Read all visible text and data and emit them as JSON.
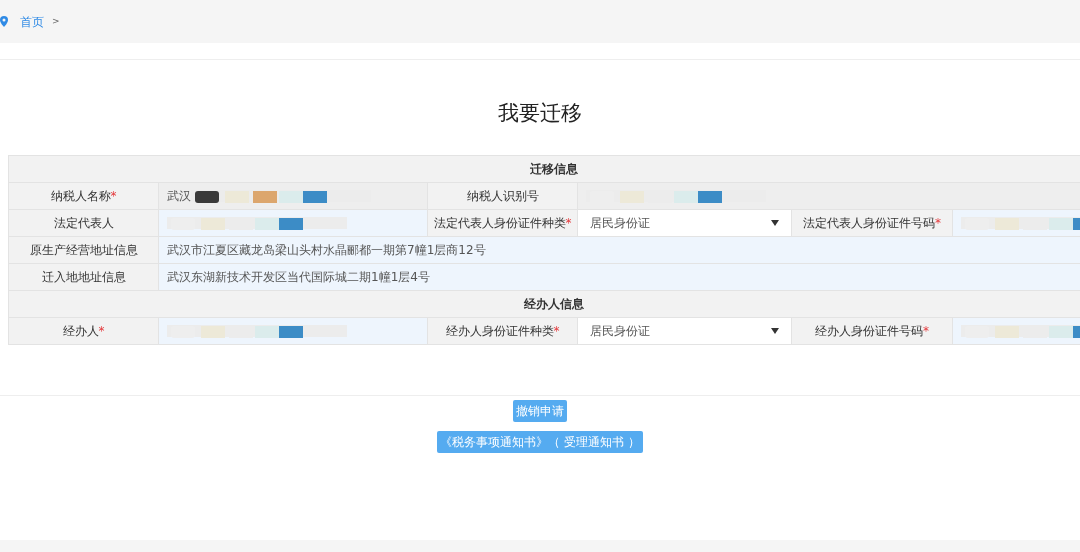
{
  "breadcrumb": {
    "items": [
      {
        "label": "首页"
      }
    ],
    "separator": ">"
  },
  "title": "我要迁移",
  "sections": [
    {
      "heading": "迁移信息",
      "rows": [
        {
          "cells": [
            {
              "kind": "label",
              "text": "纳税人名称",
              "mark": "*"
            },
            {
              "kind": "field",
              "value": "武汉",
              "disabled": true,
              "redacted": true
            },
            {
              "kind": "label",
              "text": "纳税人识别号"
            },
            {
              "kind": "field",
              "disabled": true,
              "redacted": true
            }
          ]
        },
        {
          "cells": [
            {
              "kind": "label",
              "text": "法定代表人"
            },
            {
              "kind": "field",
              "disabled": false,
              "redacted": true
            },
            {
              "kind": "label",
              "text": "法定代表人身份证件种类",
              "mark": "*"
            },
            {
              "kind": "select",
              "value": "居民身份证"
            },
            {
              "kind": "label",
              "text": "法定代表人身份证件号码 ",
              "mark": "*"
            },
            {
              "kind": "field",
              "disabled": false,
              "redacted": true
            }
          ]
        },
        {
          "cells": [
            {
              "kind": "label",
              "text": "原生产经营地址信息"
            },
            {
              "kind": "field",
              "value": "武汉市江夏区藏龙岛梁山头村水晶郦都一期第7幢1层商12号",
              "disabled": false,
              "redacted": false
            }
          ]
        },
        {
          "cells": [
            {
              "kind": "label",
              "text": "迁入地地址信息"
            },
            {
              "kind": "field",
              "value": "武汉东湖新技术开发区当代国际城二期1幢1层4号",
              "disabled": false,
              "redacted": false
            }
          ]
        }
      ]
    },
    {
      "heading": "经办人信息",
      "rows": [
        {
          "cells": [
            {
              "kind": "label",
              "text": "经办人",
              "mark": "*"
            },
            {
              "kind": "field",
              "disabled": false,
              "redacted": true
            },
            {
              "kind": "label",
              "text": "经办人身份证件种类",
              "mark": "*"
            },
            {
              "kind": "select",
              "value": "居民身份证"
            },
            {
              "kind": "label",
              "text": "经办人身份证件号码",
              "mark": "*"
            },
            {
              "kind": "field",
              "disabled": false,
              "redacted": true
            }
          ]
        }
      ]
    }
  ],
  "buttons": [
    {
      "label": "撤销申请"
    },
    {
      "label": "《税务事项通知书》（ 受理通知书 ）"
    }
  ]
}
